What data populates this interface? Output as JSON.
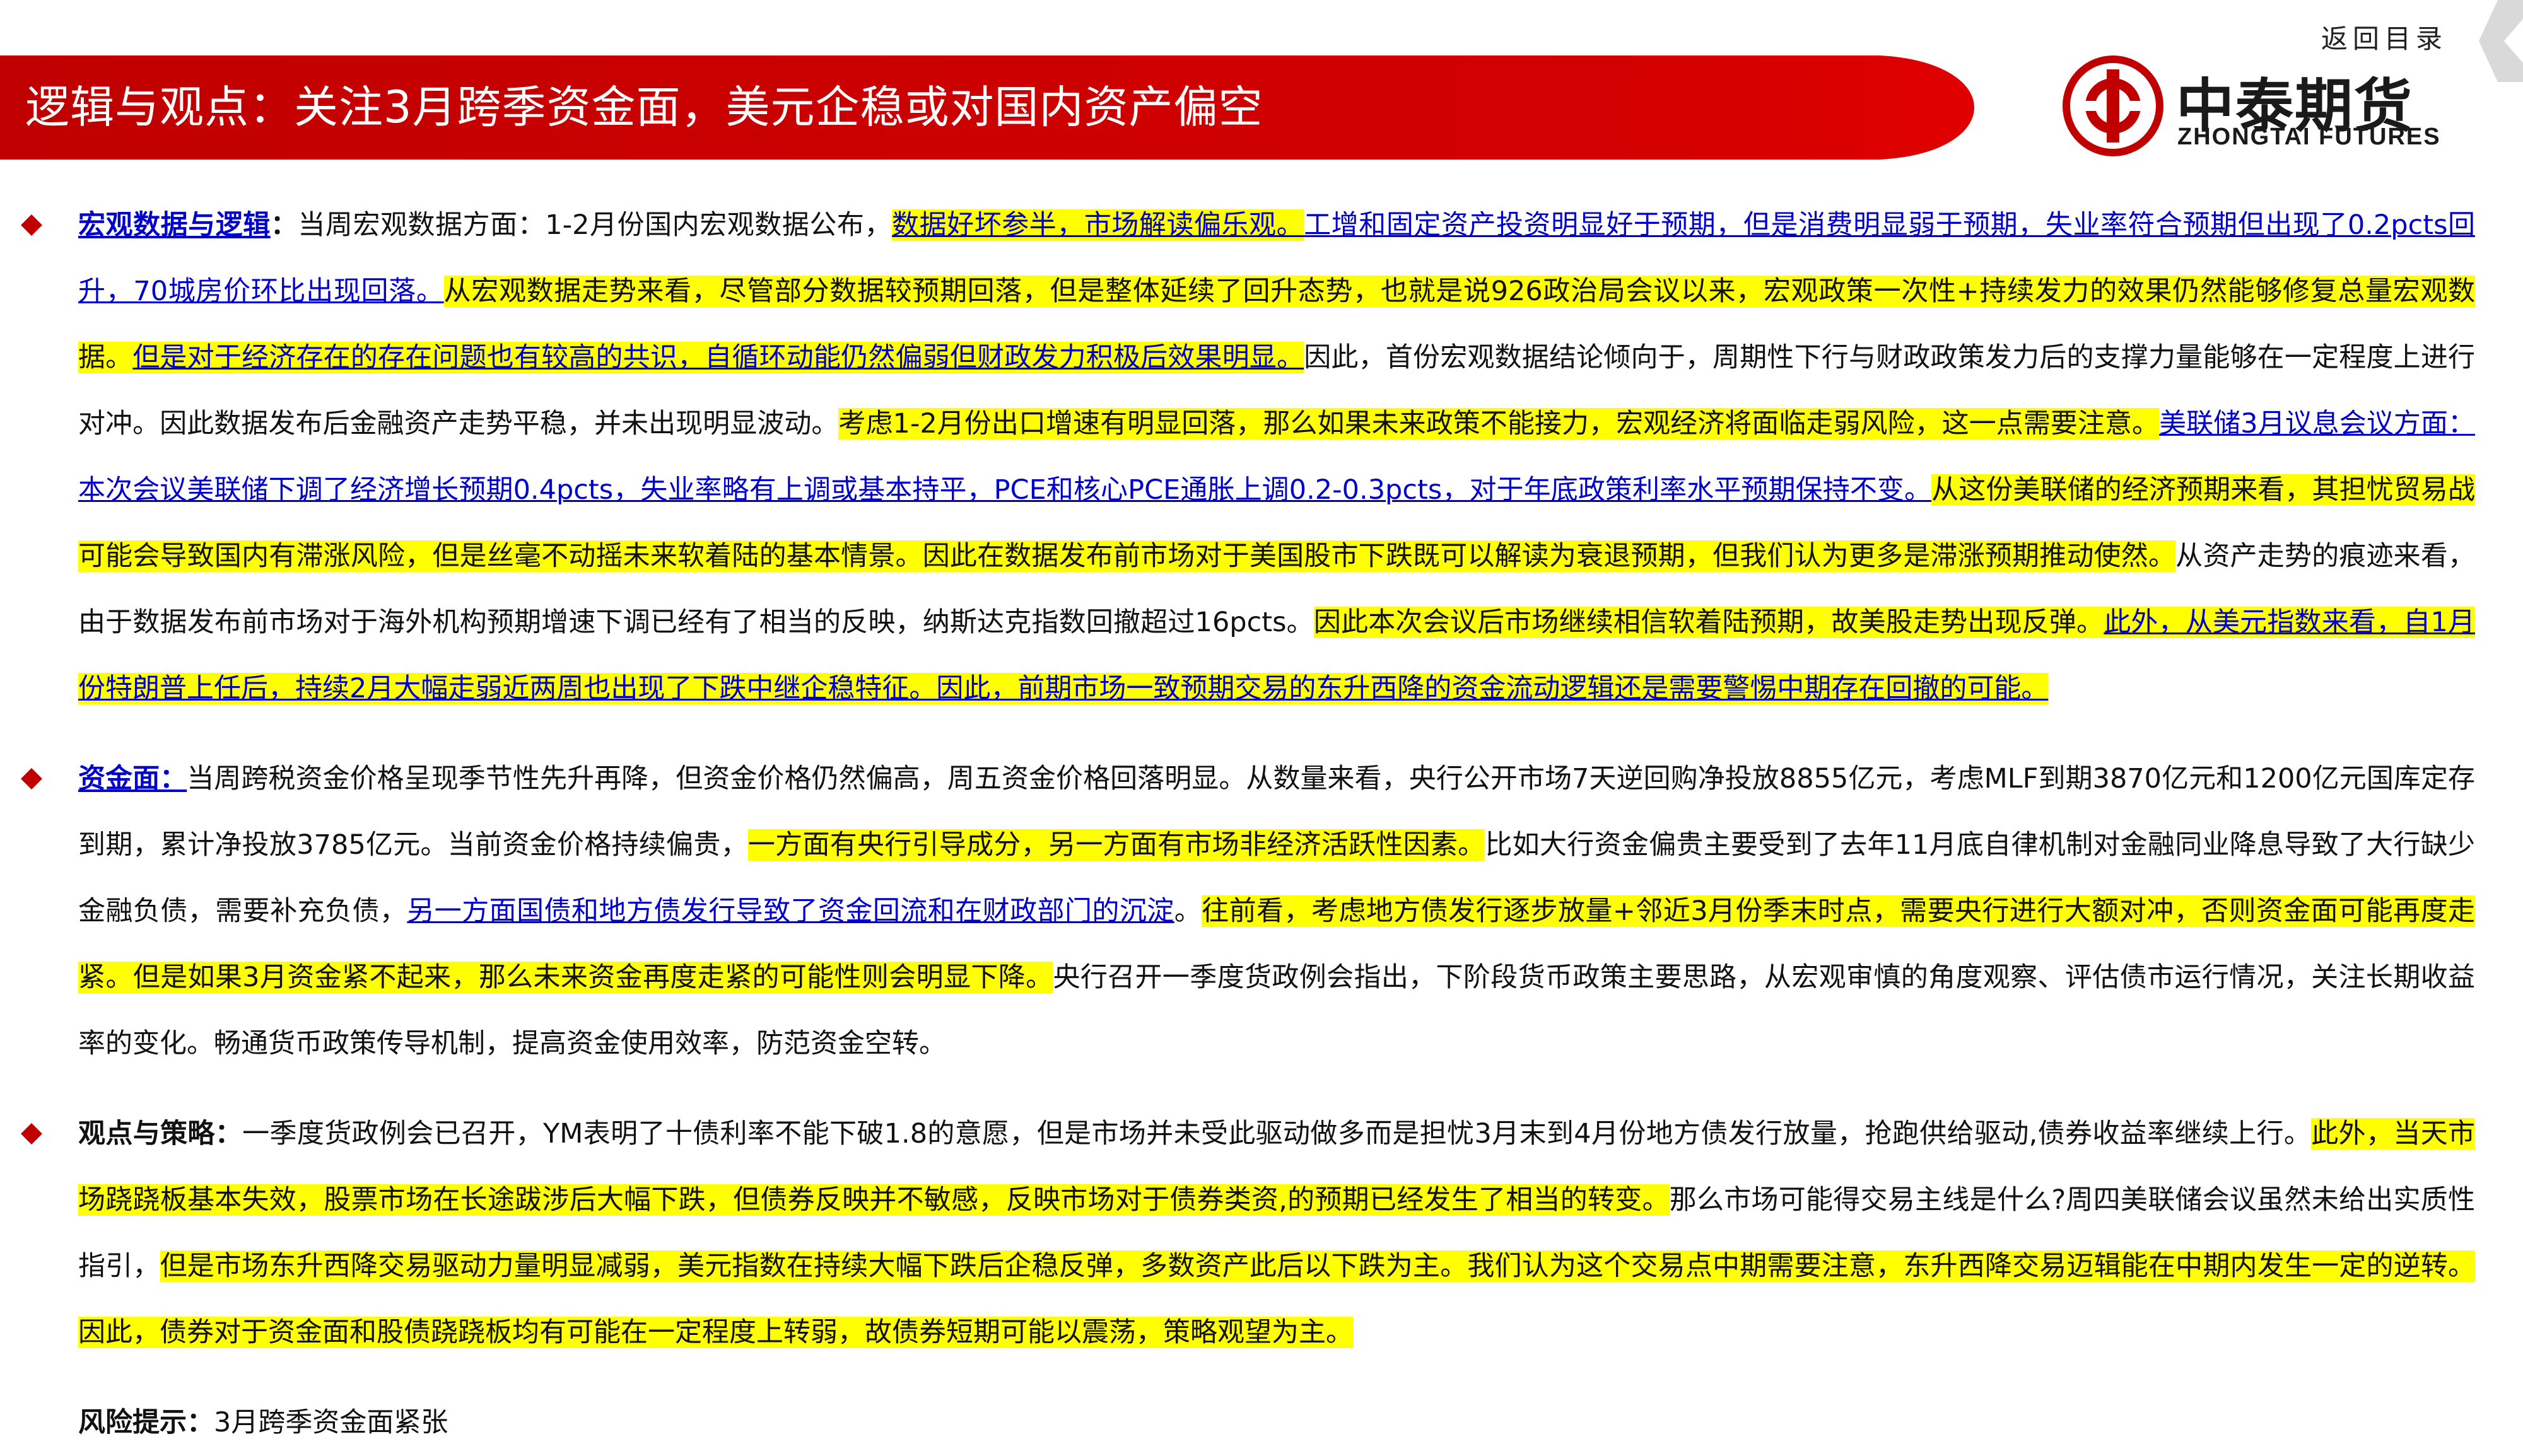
{
  "nav": {
    "return_label": "返回目录"
  },
  "header": {
    "title": "逻辑与观点：关注3月跨季资金面，美元企稳或对国内资产偏空"
  },
  "logo": {
    "cn_name": "中泰期货",
    "en_name": "ZHONGTAI FUTURES"
  },
  "colors": {
    "brand_red": "#c00000",
    "highlight": "#ffff00",
    "link_blue": "#0000cc"
  },
  "sections": [
    {
      "heading": "宏观数据与逻辑",
      "heading_sep": "：",
      "segments": [
        {
          "text": "当周宏观数据方面：1-2月份国内宏观数据公布，",
          "style": "plain"
        },
        {
          "text": "数据好坏参半，市场解读偏乐观。",
          "style": "hl-ul"
        },
        {
          "text": "工增和固定资产投资明显好于预期，但是消费明显弱于预期，失业率符合预期但出现了0.2pcts回升，70城房价环比出现回落。",
          "style": "ul"
        },
        {
          "text": "从宏观数据走势来看，尽管部分数据较预期回落，但是整体延续了回升态势，也就是说926政治局会议以来，宏观政策一次性+持续发力的效果仍然能够修复总量宏观数据。",
          "style": "hl"
        },
        {
          "text": "但是对于经济存在的存在问题也有较高的共识，自循环动能仍然偏弱但财政发力积极后效果明显。",
          "style": "hl-ul"
        },
        {
          "text": "因此，首份宏观数据结论倾向于，周期性下行与财政政策发力后的支撑力量能够在一定程度上进行对冲。因此数据发布后金融资产走势平稳，并未出现明显波动。",
          "style": "plain"
        },
        {
          "text": "考虑1-2月份出口增速有明显回落，那么如果未来政策不能接力，宏观经济将面临走弱风险，这一点需要注意。",
          "style": "hl"
        },
        {
          "text": "美联储3月议息会议方面：本次会议美联储下调了经济增长预期0.4pcts，失业率略有上调或基本持平，PCE和核心PCE通胀上调0.2-0.3pcts，对于年底政策利率水平预期保持不变。",
          "style": "ul"
        },
        {
          "text": "从这份美联储的经济预期来看，其担忧贸易战可能会导致国内有滞涨风险，但是丝毫不动摇未来软着陆的基本情景。因此在数据发布前市场对于美国股市下跌既可以解读为衰退预期，但我们认为更多是滞涨预期推动使然。",
          "style": "hl"
        },
        {
          "text": "从资产走势的痕迹来看，由于数据发布前市场对于海外机构预期增速下调已经有了相当的反映，纳斯达克指数回撤超过16pcts。",
          "style": "plain"
        },
        {
          "text": "因此本次会议后市场继续相信软着陆预期，故美股走势出现反弹。",
          "style": "hl"
        },
        {
          "text": "此外，从美元指数来看，自1月份特朗普上任后，持续2月大幅走弱近两周也出现了下跌中继企稳特征。因此，前期市场一致预期交易的东升西降的资金流动逻辑还是需要警惕中期存在回撤的可能。",
          "style": "hl-ul"
        }
      ]
    },
    {
      "heading": "资金面：",
      "heading_sep": "",
      "segments": [
        {
          "text": "当周跨税资金价格呈现季节性先升再降，但资金价格仍然偏高，周五资金价格回落明显。从数量来看，央行公开市场7天逆回购净投放8855亿元，考虑MLF到期3870亿元和1200亿元国库定存到期，累计净投放3785亿元。当前资金价格持续偏贵，",
          "style": "plain"
        },
        {
          "text": "一方面有央行引导成分，另一方面有市场非经济活跃性因素。",
          "style": "hl"
        },
        {
          "text": "比如大行资金偏贵主要受到了去年11月底自律机制对金融同业降息导致了大行缺少金融负债，需要补充负债，",
          "style": "plain"
        },
        {
          "text": "另一方面国债和地方债发行导致了资金回流和在财政部门的沉淀",
          "style": "ul"
        },
        {
          "text": "。",
          "style": "plain"
        },
        {
          "text": "往前看，考虑地方债发行逐步放量+邻近3月份季末时点，需要央行进行大额对冲，否则资金面可能再度走紧。但是如果3月资金紧不起来，那么未来资金再度走紧的可能性则会明显下降。",
          "style": "hl"
        },
        {
          "text": "央行召开一季度货政例会指出，下阶段货币政策主要思路，从宏观审慎的角度观察、评估债市运行情况，关注长期收益率的变化。畅通货币政策传导机制，提高资金使用效率，防范资金空转。",
          "style": "plain"
        }
      ]
    },
    {
      "heading": "观点与策略",
      "heading_sep": "：",
      "segments": [
        {
          "text": "一季度货政例会已召开，YM表明了十债利率不能下破1.8的意愿，但是市场并未受此驱动做多而是担忧3月末到4月份地方债发行放量，抢跑供给驱动,债券收益率继续上行。",
          "style": "plain"
        },
        {
          "text": "此外，当天市场跷跷板基本失效，股票市场在长途跋涉后大幅下跌，但债券反映并不敏感，反映市场对于债券类资,的预期已经发生了相当的转变。",
          "style": "hl"
        },
        {
          "text": "那么市场可能得交易主线是什么?周四美联储会议虽然未给出实质性指引，",
          "style": "plain"
        },
        {
          "text": "但是市场东升西降交易驱动力量明显减弱，美元指数在持续大幅下跌后企稳反弹，多数资产此后以下跌为主。我们认为这个交易点中期需要注意，东升西降交易迈辑能在中期内发生一定的逆转。因此，债券对于资金面和股债跷跷板均有可能在一定程度上转弱，故债券短期可能以震荡，策略观望为主。",
          "style": "hl"
        }
      ]
    },
    {
      "heading": "风险提示",
      "heading_sep": "：",
      "segments": [
        {
          "text": "3月跨季资金面紧张",
          "style": "plain"
        }
      ]
    }
  ]
}
